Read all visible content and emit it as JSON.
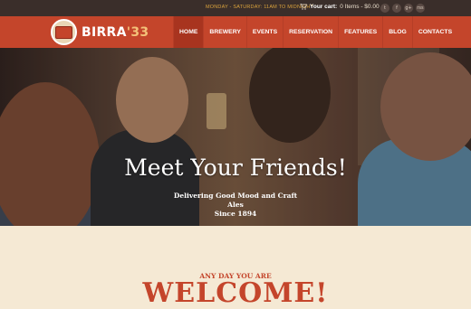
{
  "topbar": {
    "hours": "MONDAY - SATURDAY: 11AM TO MIDNIGHT",
    "cart_label": "Your cart:",
    "cart_info": "0 Items - $0.00",
    "cart_icon": "shopping-cart-icon",
    "social": [
      "t",
      "f",
      "g+",
      "rss"
    ]
  },
  "logo": {
    "name": "BIRRA",
    "number": "'33"
  },
  "nav": {
    "items": [
      "HOME",
      "BREWERY",
      "EVENTS",
      "RESERVATION",
      "FEATURES",
      "BLOG",
      "CONTACTS"
    ],
    "active": "HOME"
  },
  "hero": {
    "title": "Meet Your Friends!",
    "subtitle": "Delivering Good Mood and Craft Ales",
    "since": "Since 1894",
    "slides": 3,
    "active_slide": 1
  },
  "welcome": {
    "kicker": "ANY DAY YOU ARE",
    "heading": "WELCOME!"
  },
  "colors": {
    "brand_red": "#c4452b",
    "dark_bar": "#3a2e2a",
    "gold": "#d9a23d",
    "cream": "#f5e9d4"
  }
}
